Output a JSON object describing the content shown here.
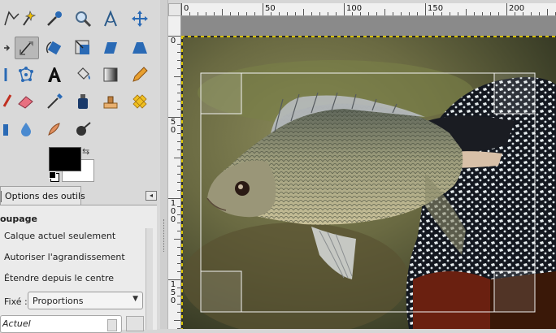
{
  "tool_options": {
    "tab_label": "Options des outils",
    "title": "oupage",
    "option_current_layer_only": "Calque actuel seulement",
    "option_allow_growing": "Autoriser l'agrandissement",
    "option_expand_from_center": "Étendre depuis le centre",
    "fixed_label": "Fixé :",
    "fixed_value": "Proportions",
    "ratio_value": "Actuel"
  },
  "ruler": {
    "h_labels": [
      "0",
      "50",
      "100",
      "150",
      "200"
    ],
    "v_labels": [
      "0",
      "5\n0",
      "1\n0\n0",
      "1\n5\n0"
    ]
  },
  "tools": [
    "free-select-icon",
    "fuzzy-select-icon",
    "color-picker-icon",
    "magnify-icon",
    "measure-icon",
    "move-icon",
    "align-icon",
    "crop-icon",
    "rotate-icon",
    "scale-icon",
    "shear-icon",
    "perspective-icon",
    "flip-icon",
    "cage-icon",
    "text-icon",
    "bucket-fill-icon",
    "blend-icon",
    "pencil-icon",
    "paintbrush-icon",
    "eraser-icon",
    "airbrush-icon",
    "ink-icon",
    "clone-icon",
    "heal-icon",
    "perspective-clone-icon",
    "blur-icon",
    "smudge-icon",
    "dodge-burn-icon"
  ],
  "colors": {
    "foreground": "#000000",
    "background": "#ffffff",
    "accent_boundary": "#d8c200"
  }
}
